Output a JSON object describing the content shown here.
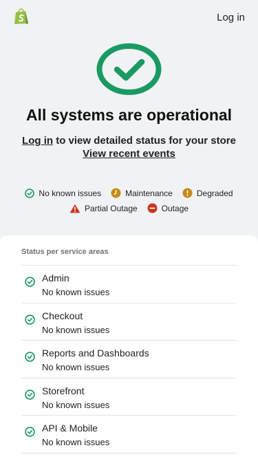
{
  "header": {
    "login_label": "Log in"
  },
  "hero": {
    "headline": "All systems are operational",
    "login_link": "Log in",
    "detail_text": " to view detailed status for your store",
    "recent_events": "View recent events"
  },
  "legend": {
    "no_issues": "No known issues",
    "maintenance": "Maintenance",
    "degraded": "Degraded",
    "partial_outage": "Partial Outage",
    "outage": "Outage"
  },
  "colors": {
    "operational": "#1a9a63",
    "maintenance": "#c58b1b",
    "degraded": "#c58b1b",
    "partial_outage": "#c8361f",
    "outage": "#c8361f",
    "brand": "#95bf47"
  },
  "services": {
    "title": "Status per service areas",
    "items": [
      {
        "name": "Admin",
        "status": "No known issues"
      },
      {
        "name": "Checkout",
        "status": "No known issues"
      },
      {
        "name": "Reports and Dashboards",
        "status": "No known issues"
      },
      {
        "name": "Storefront",
        "status": "No known issues"
      },
      {
        "name": "API & Mobile",
        "status": "No known issues"
      }
    ]
  }
}
